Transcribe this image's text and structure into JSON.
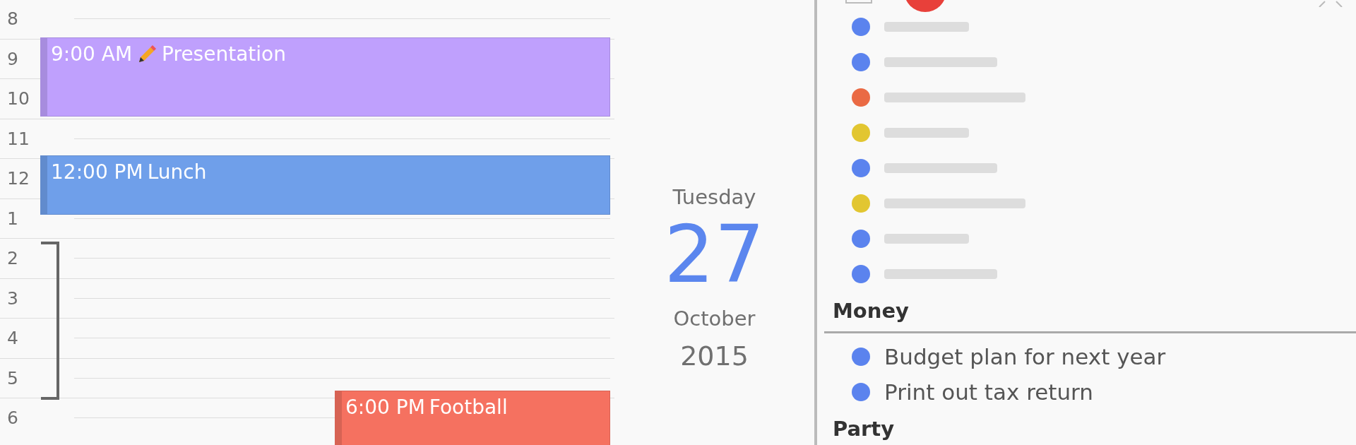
{
  "hours": [
    "8",
    "9",
    "10",
    "11",
    "12",
    "1",
    "2",
    "3",
    "4",
    "5",
    "6"
  ],
  "events": [
    {
      "time": "9:00 AM",
      "title": "Presentation",
      "has_icon": true,
      "color": "#bfa0fd"
    },
    {
      "time": "12:00 PM",
      "title": "Lunch",
      "has_icon": false,
      "color": "#6f9fea"
    },
    {
      "time": "6:00 PM",
      "title": "Football",
      "has_icon": false,
      "color": "#f57160"
    }
  ],
  "date": {
    "weekday": "Tuesday",
    "day": "27",
    "month": "October",
    "year": "2015"
  },
  "task_panel": {
    "blurred_items": [
      {
        "color": "#5b83ee"
      },
      {
        "color": "#5b83ee"
      },
      {
        "color": "#ea6a44"
      },
      {
        "color": "#e2c631"
      },
      {
        "color": "#5b83ee"
      },
      {
        "color": "#e2c631"
      },
      {
        "color": "#5b83ee"
      },
      {
        "color": "#5b83ee"
      }
    ],
    "groups": [
      {
        "title": "Money",
        "items": [
          {
            "text": "Budget plan for next year",
            "color": "#5b83ee"
          },
          {
            "text": "Print out tax return",
            "color": "#5b83ee"
          }
        ]
      },
      {
        "title": "Party"
      }
    ]
  }
}
